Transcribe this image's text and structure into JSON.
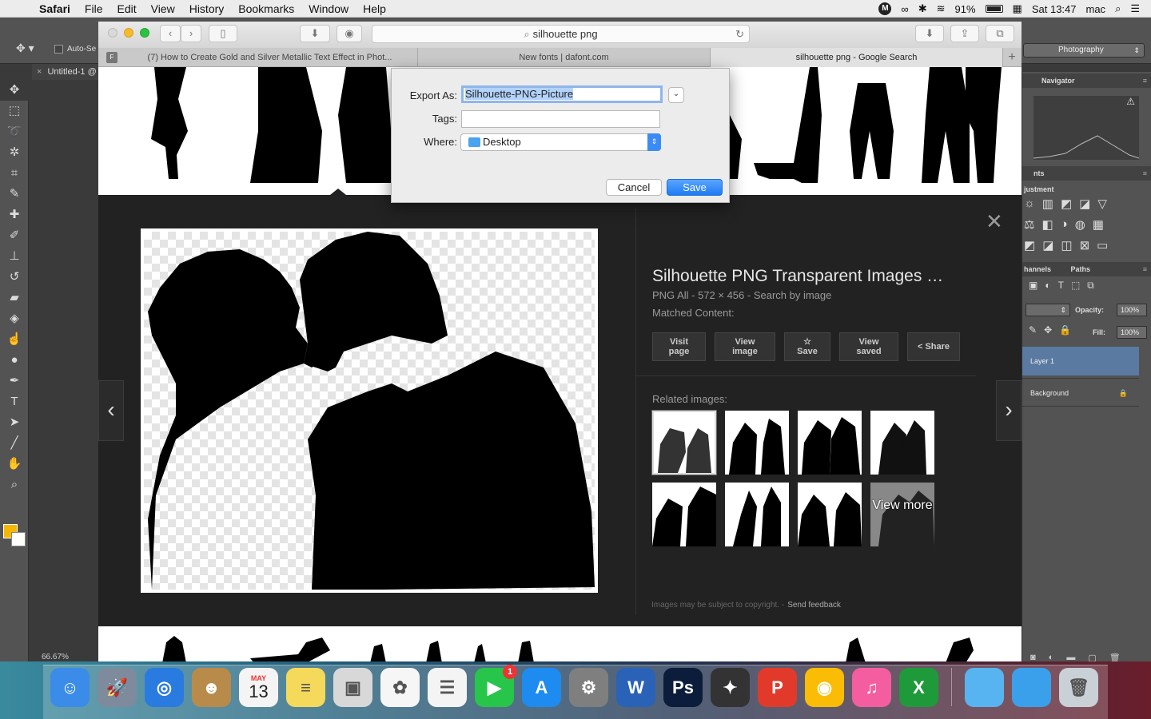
{
  "menubar": {
    "app": "Safari",
    "items": [
      "File",
      "Edit",
      "View",
      "History",
      "Bookmarks",
      "Window",
      "Help"
    ],
    "battery": "91%",
    "clock": "Sat 13:47",
    "user": "mac"
  },
  "photoshop": {
    "auto_select": "Auto-Se",
    "workspace": "Photography",
    "doc_tab": "Untitled-1 @",
    "zoom": "66.67%",
    "panels": {
      "navigator": "Navigator",
      "adjustments": "justment",
      "adjust_tab": "nts",
      "channels": "hannels",
      "paths": "Paths",
      "opacity_label": "Opacity:",
      "opacity_value": "100%",
      "fill_label": "Fill:",
      "fill_value": "100%",
      "layers": [
        "Layer 1",
        "Background"
      ]
    }
  },
  "safari": {
    "url": "silhouette png",
    "tabs": [
      "(7) How to Create Gold and Silver Metallic Text Effect in Phot...",
      "New fonts | dafont.com",
      "silhouette png - Google Search"
    ],
    "tab_favicon": "F"
  },
  "preview": {
    "title": "Silhouette PNG Transparent Images …",
    "meta": "PNG All - 572 × 456 - Search by image",
    "matched": "Matched Content:",
    "actions": [
      {
        "line1": "Visit",
        "line2": "page"
      },
      {
        "line1": "View",
        "line2": "image"
      },
      {
        "line1": "☆ Save",
        "line2": ""
      },
      {
        "line1": "View",
        "line2": "saved"
      },
      {
        "line1": "< Share",
        "line2": ""
      }
    ],
    "related_label": "Related images:",
    "view_more": "View more",
    "copyright": "Images may be subject to copyright.",
    "send_feedback": "Send feedback"
  },
  "export_dialog": {
    "export_as_label": "Export As:",
    "export_as_value": "Silhouette-PNG-Picture",
    "tags_label": "Tags:",
    "tags_value": "",
    "where_label": "Where:",
    "where_value": "Desktop",
    "cancel": "Cancel",
    "save": "Save"
  },
  "dock": {
    "calendar_month": "MAY",
    "calendar_day": "13",
    "facetime_badge": "1",
    "apps": [
      {
        "name": "Finder",
        "color": "#3b8ce8",
        "glyph": "☺"
      },
      {
        "name": "Launchpad",
        "color": "#7d8b9c",
        "glyph": "🚀"
      },
      {
        "name": "Safari",
        "color": "#2a7be0",
        "glyph": "◎"
      },
      {
        "name": "Contacts",
        "color": "#b88b4a",
        "glyph": "☻"
      },
      {
        "name": "Calendar",
        "color": "#f4f4f4",
        "glyph": ""
      },
      {
        "name": "Notes",
        "color": "#f5d95a",
        "glyph": "≡"
      },
      {
        "name": "Preview",
        "color": "#d8d8d8",
        "glyph": "▣"
      },
      {
        "name": "Photos",
        "color": "#f6f6f6",
        "glyph": "✿"
      },
      {
        "name": "Reminders",
        "color": "#f4f4f4",
        "glyph": "☰"
      },
      {
        "name": "FaceTime",
        "color": "#27c54a",
        "glyph": "▶"
      },
      {
        "name": "App Store",
        "color": "#1e8bf0",
        "glyph": "A"
      },
      {
        "name": "System Preferences",
        "color": "#7f7f7f",
        "glyph": "⚙"
      },
      {
        "name": "Word",
        "color": "#2a62b8",
        "glyph": "W"
      },
      {
        "name": "Photoshop",
        "color": "#0b1d3a",
        "glyph": "Ps"
      },
      {
        "name": "Final Cut",
        "color": "#333",
        "glyph": "✦"
      },
      {
        "name": "Kingsoft Presentation",
        "color": "#e23a2a",
        "glyph": "P"
      },
      {
        "name": "Chrome",
        "color": "#fbbc05",
        "glyph": "◉"
      },
      {
        "name": "iTunes",
        "color": "#f45ea0",
        "glyph": "♫"
      },
      {
        "name": "Excel",
        "color": "#1e9a3a",
        "glyph": "X"
      },
      {
        "name": "Downloads folder",
        "color": "#58b4f0",
        "glyph": ""
      },
      {
        "name": "Documents folder",
        "color": "#3aa0ec",
        "glyph": ""
      },
      {
        "name": "Trash",
        "color": "#c9d0d6",
        "glyph": "🗑"
      }
    ]
  }
}
